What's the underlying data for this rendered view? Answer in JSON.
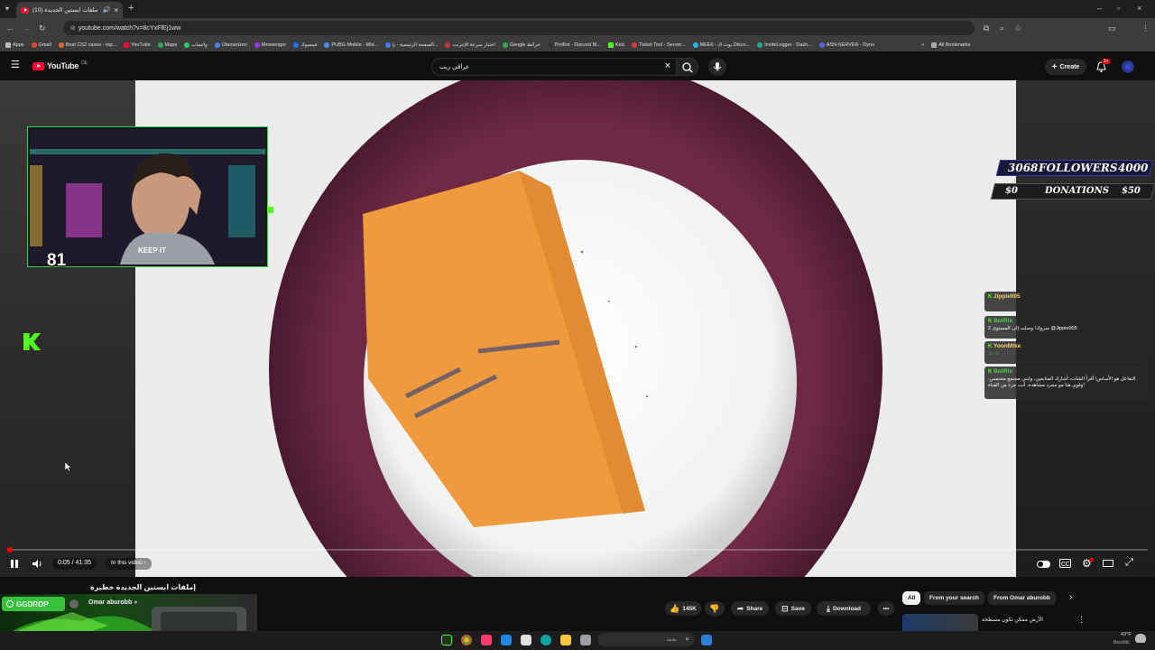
{
  "browser": {
    "tab_title": "(10) ملفات ابستين الجديدة -",
    "address": "youtube.com/watch?v=8cYxFlEj1ww",
    "bookmarks": [
      "Apps",
      "Gmail",
      "Best CS2 cases - top...",
      "YouTube",
      "Maps",
      "واتساب",
      "Übersetzen",
      "Messenger",
      "فيسبوك",
      "PUBG Mobile - Mid...",
      "الصفحة الرئيسية - بإ...",
      "اختبار سرعة الإنترنت",
      "Google خرائط",
      "ProBot - Discord M...",
      "Kick",
      "Ticket Tool - Server...",
      "MEE6 - بوت الـ Disco...",
      "InviteLogger - Dash...",
      "ASN-SERVER - Dyno"
    ],
    "all_bookmarks": "All Bookmarks"
  },
  "youtube": {
    "logo": "YouTube",
    "region": "DE",
    "search_value": "عراقي ريب",
    "create_label": "Create",
    "notif_badge": "9+"
  },
  "stream": {
    "webcam_count": "81",
    "webcam_shirt": "KEEP IT",
    "followers_current": "3068",
    "followers_label": "FOLLOWERS",
    "followers_goal": "4000",
    "donations_current": "$0",
    "donations_label": "DONATIONS",
    "donations_goal": "$50",
    "chat": [
      {
        "name": "Jippie005",
        "msg": "",
        "color": "#f1d36a"
      },
      {
        "name": "BotRix",
        "msg": "مبروك! وصلت إلى المستوى 2 @Jippie005",
        "color": "#4fd04f"
      },
      {
        "name": "YoonMike",
        "msg": "",
        "color": "#f1d36a"
      },
      {
        "name": "BotRix",
        "msg": "التفاعل هو الأساس! أقرأ الشات، أشارك المتابعين، وابني مجتمع متحمس. وقوي هنا مو مجرد مشاهدة، أنت جزء من القناة!",
        "color": "#4fd04f"
      }
    ]
  },
  "player": {
    "progress_fraction": 0.002,
    "time": "0:05 / 41:35",
    "chapter": "In this video"
  },
  "video": {
    "title": "إملفات ابستين الجديدة خطيرة",
    "channel": "Omar aburobb",
    "likes": "145K",
    "share": "Share",
    "save": "Save",
    "download": "Download"
  },
  "sidebar": {
    "chips": [
      "All",
      "From your search",
      "From Omar aburobb"
    ],
    "next_title": "الأرض ممكن تكون مسطحة"
  },
  "ad": {
    "brand": "GGDROP"
  },
  "taskbar": {
    "search_placeholder": "بحث",
    "weather": "43°F",
    "weather_sub": "Bewölkt"
  },
  "colors": {
    "youtube_red": "#ff0033",
    "kick_green": "#53fc18",
    "progress_red": "#ff0000"
  }
}
